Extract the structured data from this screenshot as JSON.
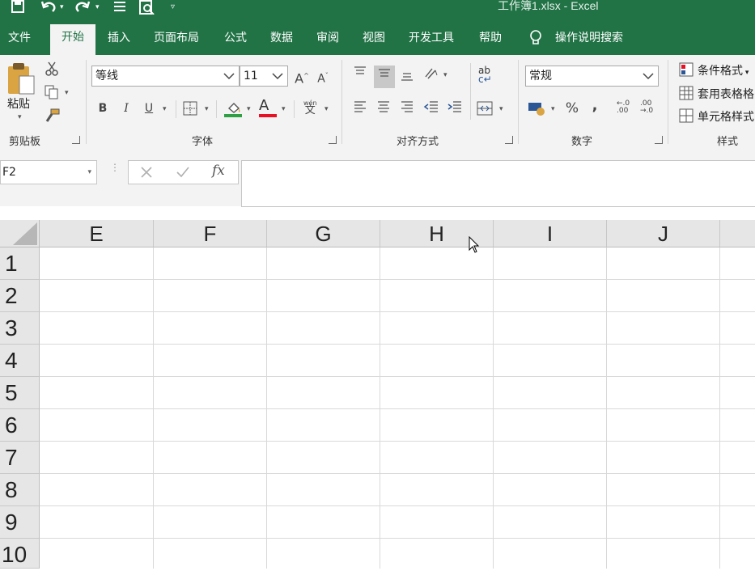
{
  "window": {
    "title": "工作簿1.xlsx  -  Excel"
  },
  "menu": {
    "tabs": [
      {
        "label": "文件"
      },
      {
        "label": "开始"
      },
      {
        "label": "插入"
      },
      {
        "label": "页面布局"
      },
      {
        "label": "公式"
      },
      {
        "label": "数据"
      },
      {
        "label": "审阅"
      },
      {
        "label": "视图"
      },
      {
        "label": "开发工具"
      },
      {
        "label": "帮助"
      }
    ],
    "tell_me": "操作说明搜索"
  },
  "ribbon": {
    "clipboard": {
      "paste_label": "粘贴",
      "group_label": "剪贴板"
    },
    "font": {
      "font_name": "等线",
      "font_size": "11",
      "group_label": "字体",
      "bold": "B",
      "italic": "I",
      "underline": "U",
      "font_color_letter": "A",
      "phonetic_top": "wén",
      "phonetic_bottom": "文",
      "grow": "A",
      "shrink": "A"
    },
    "alignment": {
      "group_label": "对齐方式",
      "wrap": "ab"
    },
    "number": {
      "format": "常规",
      "group_label": "数字",
      "percent": "%",
      "comma": ",",
      "inc_decimal": "←.0 .00",
      "dec_decimal": ".00 →.0"
    },
    "styles": {
      "conditional": "条件格式",
      "table": "套用表格格",
      "cell": "单元格样式",
      "group_label": "样式"
    }
  },
  "formula_bar": {
    "name_box": "F2",
    "fx": "fx"
  },
  "grid": {
    "columns": [
      "E",
      "F",
      "G",
      "H",
      "I",
      "J"
    ],
    "rows": [
      "1",
      "2",
      "3",
      "4",
      "5",
      "6",
      "7",
      "8",
      "9",
      "10"
    ]
  },
  "colors": {
    "accent": "#217346",
    "ribbon_bg": "#f3f3f3",
    "font_color_bar": "#e81123",
    "fill_color_bar": "#2ea043"
  }
}
